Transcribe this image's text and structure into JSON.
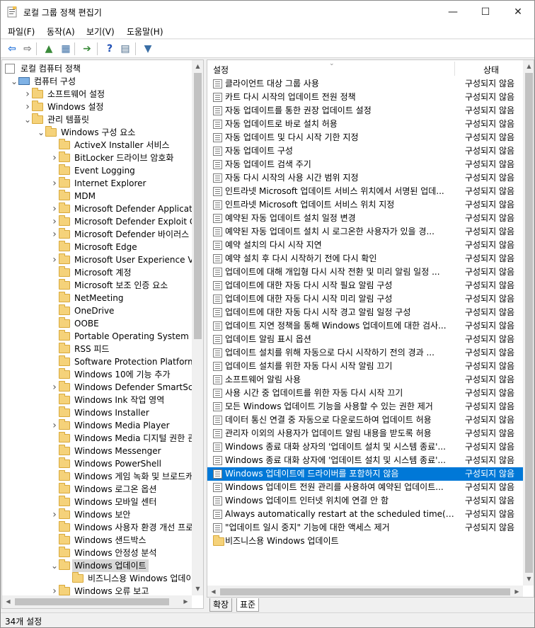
{
  "window": {
    "title": "로컬 그룹 정책 편집기",
    "controls": {
      "minimize": "—",
      "maximize": "☐",
      "close": "✕"
    }
  },
  "menubar": [
    "파일(F)",
    "동작(A)",
    "보기(V)",
    "도움말(H)"
  ],
  "toolbar": [
    {
      "name": "back-arrow-icon",
      "glyph": "⇦",
      "color": "#1e6fd9"
    },
    {
      "name": "forward-arrow-icon",
      "glyph": "⇨",
      "color": "#7a7a7a"
    },
    {
      "name": "up-folder-icon",
      "glyph": "▲",
      "color": "#3a8a3a"
    },
    {
      "name": "show-hide-tree-icon",
      "glyph": "▦",
      "color": "#3a6ea5"
    },
    {
      "name": "export-list-icon",
      "glyph": "➔",
      "color": "#3a8a3a"
    },
    {
      "name": "help-icon",
      "glyph": "?",
      "color": "#1e4fb5"
    },
    {
      "name": "properties-icon",
      "glyph": "▤",
      "color": "#4a6a8a"
    },
    {
      "name": "filter-icon",
      "glyph": "▼",
      "color": "#3a6ea5"
    }
  ],
  "tree": [
    {
      "label": "로컬 컴퓨터 정책",
      "level": 0,
      "expander": "",
      "icon": "policy"
    },
    {
      "label": "컴퓨터 구성",
      "level": 1,
      "expander": "open",
      "icon": "computer"
    },
    {
      "label": "소프트웨어 설정",
      "level": 2,
      "expander": "closed",
      "icon": "folder"
    },
    {
      "label": "Windows 설정",
      "level": 2,
      "expander": "closed",
      "icon": "folder"
    },
    {
      "label": "관리 템플릿",
      "level": 2,
      "expander": "open",
      "icon": "folder"
    },
    {
      "label": "Windows 구성 요소",
      "level": 3,
      "expander": "open",
      "icon": "folder"
    },
    {
      "label": "ActiveX Installer 서비스",
      "level": 4,
      "expander": "",
      "icon": "folder"
    },
    {
      "label": "BitLocker 드라이브 암호화",
      "level": 4,
      "expander": "closed",
      "icon": "folder"
    },
    {
      "label": "Event Logging",
      "level": 4,
      "expander": "",
      "icon": "folder"
    },
    {
      "label": "Internet Explorer",
      "level": 4,
      "expander": "closed",
      "icon": "folder"
    },
    {
      "label": "MDM",
      "level": 4,
      "expander": "",
      "icon": "folder"
    },
    {
      "label": "Microsoft Defender Applicatio",
      "level": 4,
      "expander": "closed",
      "icon": "folder"
    },
    {
      "label": "Microsoft Defender Exploit Gua",
      "level": 4,
      "expander": "closed",
      "icon": "folder"
    },
    {
      "label": "Microsoft Defender 바이러스 백",
      "level": 4,
      "expander": "closed",
      "icon": "folder"
    },
    {
      "label": "Microsoft Edge",
      "level": 4,
      "expander": "",
      "icon": "folder"
    },
    {
      "label": "Microsoft User Experience Virtu",
      "level": 4,
      "expander": "closed",
      "icon": "folder"
    },
    {
      "label": "Microsoft 계정",
      "level": 4,
      "expander": "",
      "icon": "folder"
    },
    {
      "label": "Microsoft 보조 인증 요소",
      "level": 4,
      "expander": "",
      "icon": "folder"
    },
    {
      "label": "NetMeeting",
      "level": 4,
      "expander": "",
      "icon": "folder"
    },
    {
      "label": "OneDrive",
      "level": 4,
      "expander": "",
      "icon": "folder"
    },
    {
      "label": "OOBE",
      "level": 4,
      "expander": "",
      "icon": "folder"
    },
    {
      "label": "Portable Operating System",
      "level": 4,
      "expander": "",
      "icon": "folder"
    },
    {
      "label": "RSS 피드",
      "level": 4,
      "expander": "",
      "icon": "folder"
    },
    {
      "label": "Software Protection Platform",
      "level": 4,
      "expander": "",
      "icon": "folder"
    },
    {
      "label": "Windows 10에 기능 추가",
      "level": 4,
      "expander": "",
      "icon": "folder"
    },
    {
      "label": "Windows Defender SmartScree",
      "level": 4,
      "expander": "closed",
      "icon": "folder"
    },
    {
      "label": "Windows Ink 작업 영역",
      "level": 4,
      "expander": "",
      "icon": "folder"
    },
    {
      "label": "Windows Installer",
      "level": 4,
      "expander": "",
      "icon": "folder"
    },
    {
      "label": "Windows Media Player",
      "level": 4,
      "expander": "closed",
      "icon": "folder"
    },
    {
      "label": "Windows Media 디지털 권한 관",
      "level": 4,
      "expander": "",
      "icon": "folder"
    },
    {
      "label": "Windows Messenger",
      "level": 4,
      "expander": "",
      "icon": "folder"
    },
    {
      "label": "Windows PowerShell",
      "level": 4,
      "expander": "",
      "icon": "folder"
    },
    {
      "label": "Windows 게임 녹화 및 브로드캐",
      "level": 4,
      "expander": "",
      "icon": "folder"
    },
    {
      "label": "Windows 로그온 옵션",
      "level": 4,
      "expander": "",
      "icon": "folder"
    },
    {
      "label": "Windows 모바일 센터",
      "level": 4,
      "expander": "",
      "icon": "folder"
    },
    {
      "label": "Windows 보안",
      "level": 4,
      "expander": "closed",
      "icon": "folder"
    },
    {
      "label": "Windows 사용자 환경 개선 프로",
      "level": 4,
      "expander": "",
      "icon": "folder"
    },
    {
      "label": "Windows 샌드박스",
      "level": 4,
      "expander": "",
      "icon": "folder"
    },
    {
      "label": "Windows 안정성 분석",
      "level": 4,
      "expander": "",
      "icon": "folder"
    },
    {
      "label": "Windows 업데이트",
      "level": 4,
      "expander": "open",
      "icon": "folder-open",
      "selected_inactive": true
    },
    {
      "label": "비즈니스용 Windows 업데이",
      "level": 5,
      "expander": "",
      "icon": "folder"
    },
    {
      "label": "Windows 오류 보고",
      "level": 4,
      "expander": "closed",
      "icon": "folder"
    }
  ],
  "list": {
    "columns": {
      "setting": "설정",
      "state": "상태"
    },
    "rows": [
      {
        "name": "클라이언트 대상 그룹 사용",
        "state": "구성되지 않음"
      },
      {
        "name": "카트 다시 시작의 업데이트 전원 정책",
        "state": "구성되지 않음"
      },
      {
        "name": "자동 업데이트를 통한 권장 업데이트 설정",
        "state": "구성되지 않음"
      },
      {
        "name": "자동 업데이트로 바로 설치 허용",
        "state": "구성되지 않음"
      },
      {
        "name": "자동 업데이트 및 다시 시작 기한 지정",
        "state": "구성되지 않음"
      },
      {
        "name": "자동 업데이트 구성",
        "state": "구성되지 않음"
      },
      {
        "name": "자동 업데이트 검색 주기",
        "state": "구성되지 않음"
      },
      {
        "name": "자동 다시 시작의 사용 시간 범위 지정",
        "state": "구성되지 않음"
      },
      {
        "name": "인트라넷 Microsoft 업데이트 서비스 위치에서 서명된 업데...",
        "state": "구성되지 않음"
      },
      {
        "name": "인트라넷 Microsoft 업데이트 서비스 위치 지정",
        "state": "구성되지 않음"
      },
      {
        "name": "예약된 자동 업데이트 설치 일정 변경",
        "state": "구성되지 않음"
      },
      {
        "name": "예약된 자동 업데이트 설치 시 로그온한 사용자가 있을 경...",
        "state": "구성되지 않음"
      },
      {
        "name": "예약 설치의 다시 시작 지연",
        "state": "구성되지 않음"
      },
      {
        "name": "예약 설치 후 다시 시작하기 전에 다시 확인",
        "state": "구성되지 않음"
      },
      {
        "name": "업데이트에 대해 개입형 다시 시작 전환 및 미리 알림 일정 ...",
        "state": "구성되지 않음"
      },
      {
        "name": "업데이트에 대한 자동 다시 시작 필요 알림 구성",
        "state": "구성되지 않음"
      },
      {
        "name": "업데이트에 대한 자동 다시 시작 미리 알림 구성",
        "state": "구성되지 않음"
      },
      {
        "name": "업데이트에 대한 자동 다시 시작 경고 알림 일정 구성",
        "state": "구성되지 않음"
      },
      {
        "name": "업데이트 지연 정책을 통해 Windows 업데이트에 대한 검사...",
        "state": "구성되지 않음"
      },
      {
        "name": "업데이트 알림 표시 옵션",
        "state": "구성되지 않음"
      },
      {
        "name": "업데이트 설치를 위해 자동으로 다시 시작하기 전의 경과 ...",
        "state": "구성되지 않음"
      },
      {
        "name": "업데이트 설치를 위한 자동 다시 시작 알림 끄기",
        "state": "구성되지 않음"
      },
      {
        "name": "소프트웨어 알림 사용",
        "state": "구성되지 않음"
      },
      {
        "name": "사용 시간 중 업데이트를 위한 자동 다시 시작 끄기",
        "state": "구성되지 않음"
      },
      {
        "name": "모든 Windows 업데이트 기능을 사용할 수 있는 권한 제거",
        "state": "구성되지 않음"
      },
      {
        "name": "데이터 통신 연결 중 자동으로 다운로드하여 업데이트 허용",
        "state": "구성되지 않음"
      },
      {
        "name": "관리자 이외의 사용자가 업데이트 알림 내용을 받도록 허용",
        "state": "구성되지 않음"
      },
      {
        "name": "Windows 종료 대화 상자의 '업데이트 설치 및 시스템 종료'...",
        "state": "구성되지 않음"
      },
      {
        "name": "Windows 종료 대화 상자에 '업데이트 설치 및 시스템 종료'...",
        "state": "구성되지 않음"
      },
      {
        "name": "Windows 업데이트에 드라이버를 포함하지 않음",
        "state": "구성되지 않음",
        "selected": true
      },
      {
        "name": "Windows 업데이트 전원 관리를 사용하여 예약된 업데이트...",
        "state": "구성되지 않음"
      },
      {
        "name": "Windows 업데이트 인터넷 위치에 연결 안 함",
        "state": "구성되지 않음"
      },
      {
        "name": "Always automatically restart at the scheduled time(항상 예...",
        "state": "구성되지 않음"
      },
      {
        "name": "\"업데이트 일시 중지\" 기능에 대한 액세스 제거",
        "state": "구성되지 않음"
      },
      {
        "name": "비즈니스용 Windows 업데이트",
        "state": "",
        "folder": true
      }
    ]
  },
  "tabs": [
    "확장",
    "표준"
  ],
  "status": {
    "text": "34개 설정"
  },
  "colors": {
    "selection": "#0078d7",
    "folder": "#f5d27a"
  }
}
